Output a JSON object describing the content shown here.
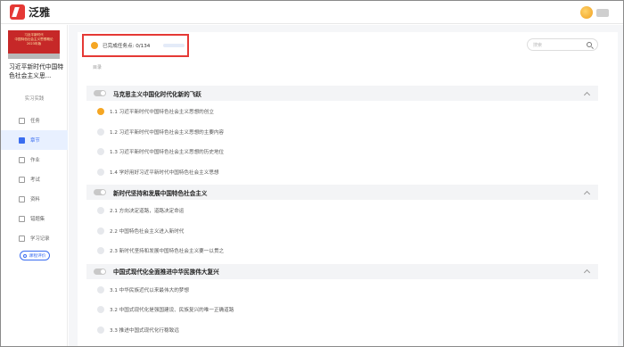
{
  "app": {
    "brand": "泛雅"
  },
  "book": {
    "cover_lines": [
      "习近平新时代",
      "中国特色社会主义思想概论",
      "2023年版"
    ],
    "title": "习近平新时代中国特色社会主义思..."
  },
  "nav": {
    "header": "实习实践",
    "items": [
      {
        "label": "任务",
        "icon": "task-icon",
        "active": false
      },
      {
        "label": "章节",
        "icon": "chapter-icon",
        "active": true
      },
      {
        "label": "作业",
        "icon": "homework-icon",
        "active": false
      },
      {
        "label": "考试",
        "icon": "exam-icon",
        "active": false
      },
      {
        "label": "资料",
        "icon": "materials-icon",
        "active": false
      },
      {
        "label": "错题集",
        "icon": "mistakes-icon",
        "active": false
      },
      {
        "label": "学习记录",
        "icon": "record-icon",
        "active": false
      }
    ],
    "button_label": "课程评价"
  },
  "progress": {
    "text": "已完成任务点: 0/134",
    "completed": 0,
    "total": 134
  },
  "search": {
    "placeholder": "搜索"
  },
  "toc_label": "目录",
  "chapters": [
    {
      "title": "马克思主义中国化时代化新的飞跃",
      "sections": [
        {
          "text": "1.1 习近平新时代中国特色社会主义思想的创立",
          "current": true
        },
        {
          "text": "1.2 习近平新时代中国特色社会主义思想的主要内容",
          "current": false
        },
        {
          "text": "1.3 习近平新时代中国特色社会主义思想的历史地位",
          "current": false
        },
        {
          "text": "1.4 学好用好习近平新时代中国特色社会主义思想",
          "current": false
        }
      ]
    },
    {
      "title": "新时代坚持和发展中国特色社会主义",
      "sections": [
        {
          "text": "2.1 方向决定道路，道路决定命运",
          "current": false
        },
        {
          "text": "2.2 中国特色社会主义进入新时代",
          "current": false
        },
        {
          "text": "2.3 新时代坚持和发展中国特色社会主义要一以贯之",
          "current": false
        }
      ]
    },
    {
      "title": "中国式现代化全面推进中华民族伟大复兴",
      "sections": [
        {
          "text": "3.1 中华民族近代以来最伟大的梦想",
          "current": false
        },
        {
          "text": "3.2 中国式现代化是强国建设、民族复兴的唯一正确道路",
          "current": false
        },
        {
          "text": "3.3 推进中国式现代化行稳致远",
          "current": false
        }
      ]
    }
  ]
}
